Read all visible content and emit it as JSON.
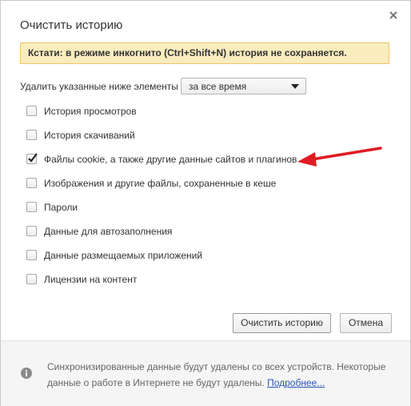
{
  "dialog": {
    "title": "Очистить историю",
    "close_icon": "close-icon"
  },
  "tip": {
    "text": "Кстати: в режиме инкогнито (Ctrl+Shift+N) история не сохраняется."
  },
  "range": {
    "label": "Удалить указанные ниже элементы",
    "selected": "за все время"
  },
  "options": [
    {
      "label": "История просмотров",
      "checked": false
    },
    {
      "label": "История скачиваний",
      "checked": false
    },
    {
      "label": "Файлы cookie, а также другие данные сайтов и плагинов",
      "checked": true
    },
    {
      "label": "Изображения и другие файлы, сохраненные в кеше",
      "checked": false
    },
    {
      "label": "Пароли",
      "checked": false
    },
    {
      "label": "Данные для автозаполнения",
      "checked": false
    },
    {
      "label": "Данные размещаемых приложений",
      "checked": false
    },
    {
      "label": "Лицензии на контент",
      "checked": false
    }
  ],
  "buttons": {
    "clear": "Очистить историю",
    "cancel": "Отмена"
  },
  "footer": {
    "text": "Синхронизированные данные будут удалены со всех устройств. Некоторые данные о работе в Интернете не будут удалены.",
    "link": "Подробнее..."
  },
  "colors": {
    "tip_bg": "#f9edbe",
    "tip_border": "#f0c36d",
    "annotation_arrow": "#e01b24",
    "link": "#2a54b4"
  }
}
